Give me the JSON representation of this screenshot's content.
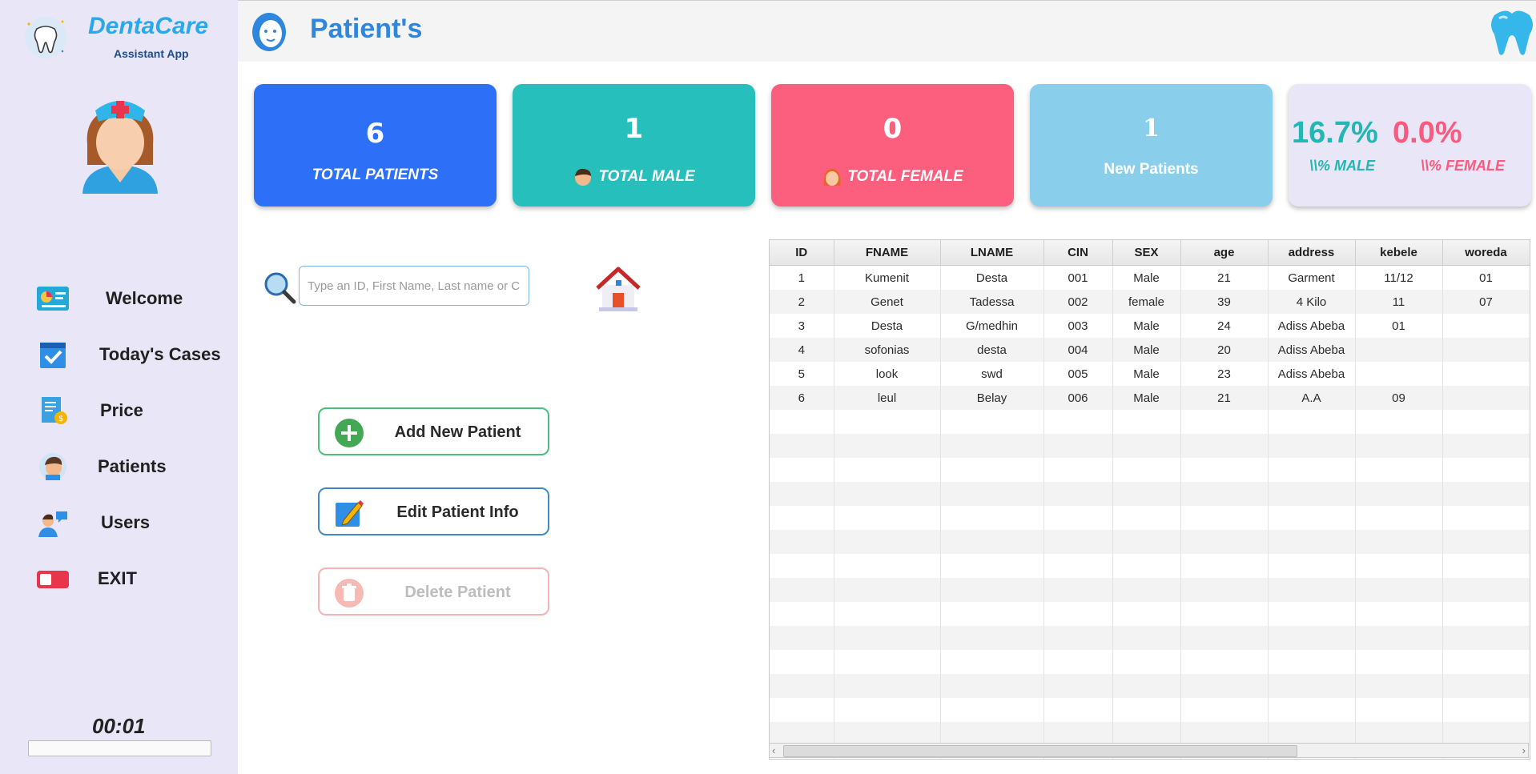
{
  "brand": {
    "name": "DentaCare",
    "subtitle": "Assistant App"
  },
  "sidebar": {
    "items": [
      {
        "label": "Welcome",
        "icon": "dashboard-icon"
      },
      {
        "label": "Today's Cases",
        "icon": "calendar-check-icon"
      },
      {
        "label": "Price",
        "icon": "invoice-coin-icon"
      },
      {
        "label": "Patients",
        "icon": "patient-avatar-icon"
      },
      {
        "label": "Users",
        "icon": "user-chat-icon"
      },
      {
        "label": "EXIT",
        "icon": "exit-toggle-icon"
      }
    ],
    "timer": "00:01",
    "progress": 0
  },
  "header": {
    "title": "Patient's"
  },
  "stats": {
    "total_patients": {
      "value": "6",
      "label": "TOTAL PATIENTS"
    },
    "total_male": {
      "value": "1",
      "label": "TOTAL MALE"
    },
    "total_female": {
      "value": "0",
      "label": "TOTAL FEMALE"
    },
    "new_patients": {
      "value": "1",
      "label": "New Patients"
    },
    "percent": {
      "male": "16.7%",
      "female": "0.0%",
      "male_label": "\\\\% MALE",
      "female_label": "\\\\% FEMALE"
    }
  },
  "search": {
    "placeholder": "Type an ID, First Name, Last name or CIN",
    "value": ""
  },
  "actions": {
    "add": "Add New Patient",
    "edit": "Edit Patient Info",
    "delete": "Delete Patient"
  },
  "table": {
    "columns": [
      "ID",
      "FNAME",
      "LNAME",
      "CIN",
      "SEX",
      "age",
      "address",
      "kebele",
      "woreda"
    ],
    "rows": [
      [
        "1",
        "Kumenit",
        "Desta",
        "001",
        "Male",
        "21",
        "Garment",
        "11/12",
        "01"
      ],
      [
        "2",
        "Genet",
        "Tadessa",
        "002",
        "female",
        "39",
        "4 Kilo",
        "11",
        "07"
      ],
      [
        "3",
        "Desta",
        "G/medhin",
        "003",
        "Male",
        "24",
        "Adiss Abeba",
        "01",
        ""
      ],
      [
        "4",
        "sofonias",
        "desta",
        "004",
        "Male",
        "20",
        "Adiss Abeba",
        "",
        ""
      ],
      [
        "5",
        "look",
        "swd",
        "005",
        "Male",
        "23",
        "Adiss Abeba",
        "",
        ""
      ],
      [
        "6",
        "leul",
        "Belay",
        "006",
        "Male",
        "21",
        "A.A",
        "09",
        ""
      ]
    ],
    "empty_rows": 15
  },
  "colors": {
    "blue": "#2d6ff6",
    "teal": "#26bfbb",
    "pink": "#fc5e7e",
    "sky": "#89cfeb",
    "lavender": "#e9e6f7"
  }
}
